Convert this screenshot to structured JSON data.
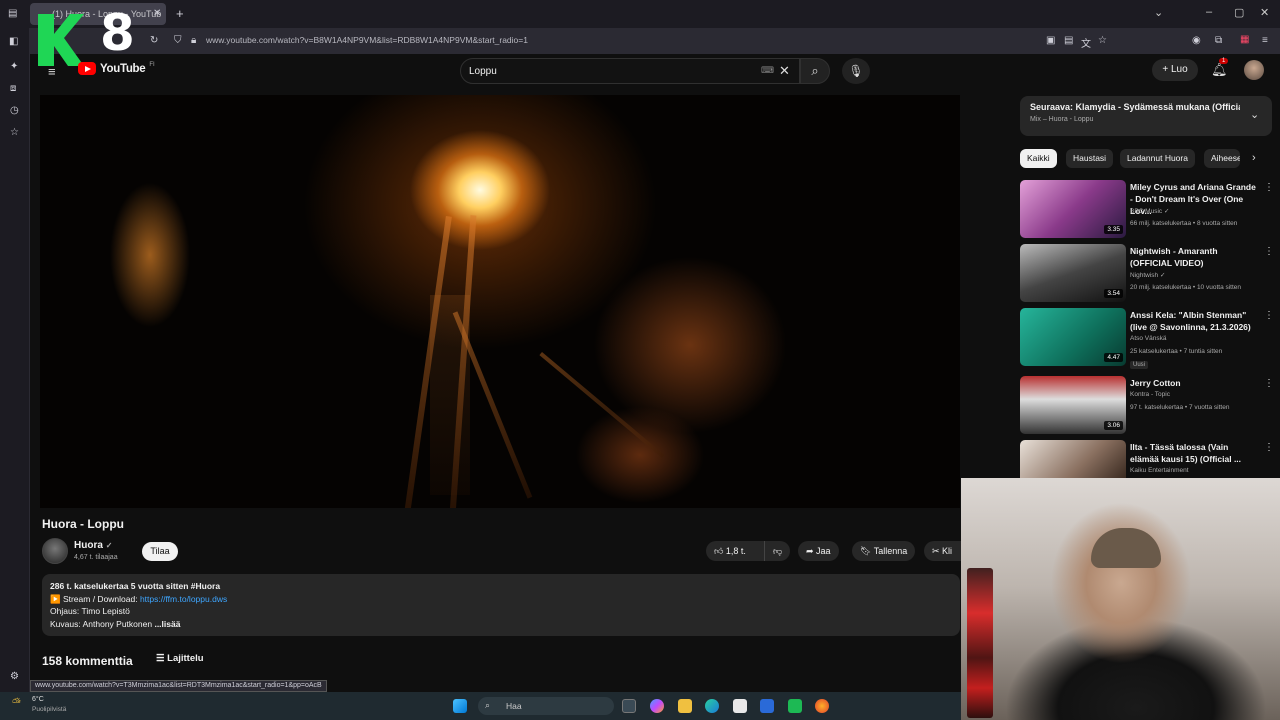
{
  "browser": {
    "tab_title": "(1) Huora - Loppu - YouTub",
    "url": "www.youtube.com/watch?v=B8W1A4NP9VM&list=RDB8W1A4NP9VM&start_radio=1",
    "status_url": "www.youtube.com/watch?v=T3Mmzima1ac&list=RDT3Mmzima1ac&start_radio=1&pp=oAcB"
  },
  "overlay": {
    "k_letter": "K",
    "number": "8"
  },
  "header": {
    "logo_text": "YouTube",
    "logo_region": "FI",
    "search_value": "Loppu",
    "create_label": "Luo",
    "notif_count": "1"
  },
  "video": {
    "title": "Huora - Loppu",
    "channel": "Huora",
    "subscribers": "4,67 t. tilaajaa",
    "subscribe_label": "Tilaa",
    "likes": "1,8 t.",
    "share_label": "Jaa",
    "save_label": "Tallenna",
    "clip_label": "Kli"
  },
  "description": {
    "stats": "286 t. katselukertaa  5 vuotta sitten  #Huora",
    "line1_prefix": "▶️ Stream / Download: ",
    "line1_link": "https://ffm.to/loppu.dws",
    "line2": "Ohjaus: Timo Lepistö",
    "line3": "Kuvaus: Anthony Putkonen",
    "more": "...lisää"
  },
  "comments": {
    "count": "158 kommenttia",
    "sort_label": "Lajittelu"
  },
  "playlist": {
    "next_title": "Seuraava: Klamydia - Sydämessä mukana (Official ...",
    "next_sub": "Mix – Huora - Loppu"
  },
  "chips": [
    "Kaikki",
    "Haustasi",
    "Ladannut Huora",
    "Aiheeseen"
  ],
  "recommendations": [
    {
      "title": "Miley Cyrus and Ariana Grande - Don't Dream It's Over (One Lov...",
      "channel": "BBC Music ✓",
      "meta": "66 milj. katselukertaa • 8 vuotta sitten",
      "duration": "3.35"
    },
    {
      "title": "Nightwish - Amaranth (OFFICIAL VIDEO)",
      "channel": "Nightwish ✓",
      "meta": "20 milj. katselukertaa • 10 vuotta sitten",
      "duration": "3.54"
    },
    {
      "title": "Anssi Kela: \"Albin Stenman\" (live @ Savonlinna, 21.3.2026)",
      "channel": "Atso Vänskä",
      "meta": "25 katselukertaa • 7 tuntia sitten",
      "duration": "4.47",
      "badge": "Uusi"
    },
    {
      "title": "Jerry Cotton",
      "channel": "Kontra - Topic",
      "meta": "97 t. katselukertaa • 7 vuotta sitten",
      "duration": "3.06"
    },
    {
      "title": "Ilta - Tässä talossa (Vain elämää kausi 15) (Official ...",
      "channel": "Kaiku Entertainment",
      "meta": "",
      "duration": ""
    }
  ],
  "taskbar": {
    "weather_temp": "6°C",
    "weather_desc": "Puolipilvistä",
    "search_placeholder": "Haa"
  },
  "colors": {
    "accent_red": "#ff0000",
    "link_blue": "#3ea6ff",
    "logo_green": "#1fd655"
  }
}
